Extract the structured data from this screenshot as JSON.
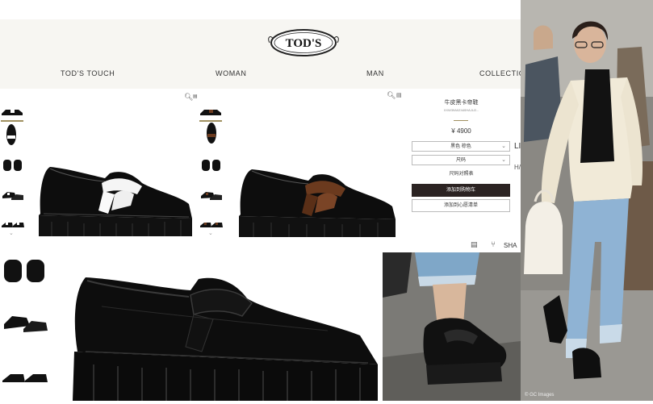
{
  "brand": {
    "logo_text": "TOD'S"
  },
  "nav": {
    "items": [
      {
        "label": "TOD'S TOUCH"
      },
      {
        "label": "WOMAN"
      },
      {
        "label": "MAN"
      },
      {
        "label": "COLLECTIO"
      }
    ]
  },
  "product": {
    "name": "牛皮黑卡帝鞋",
    "sku": "XXW39A0Z440HAJU2...",
    "price": "¥ 4900",
    "color_select": "黑色 棕色",
    "size_select": "尺码",
    "size_guide": "尺码对照表",
    "add_to_cart": "添加到购物车",
    "add_to_wishlist": "添加到心愿清单",
    "share_label": "SHA"
  },
  "side_labels": {
    "a": "LI",
    "b": "H/"
  },
  "photo_credit": "© GC Images",
  "icons": {
    "zoom": "magnifier-icon",
    "print": "print-icon",
    "share": "share-icon",
    "chevron": "chevron-down-icon"
  },
  "colors": {
    "accent": "#a09060",
    "button_dark": "#2b2322",
    "header_bg": "#f7f6f2"
  }
}
